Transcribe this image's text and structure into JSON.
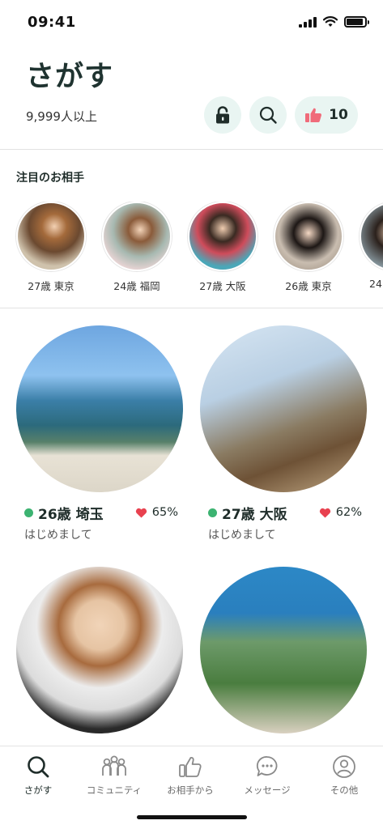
{
  "status_bar": {
    "time": "09:41",
    "battery_level": 0.9
  },
  "header": {
    "title": "さがす",
    "count_text": "9,999人以上",
    "likes_count": "10",
    "accent_color": "#e9f5f2",
    "like_icon_color": "#f06b7a"
  },
  "featured": {
    "title": "注目のお相手",
    "items": [
      {
        "label": "27歳 東京"
      },
      {
        "label": "24歳 福岡"
      },
      {
        "label": "27歳 大阪"
      },
      {
        "label": "26歳 東京"
      },
      {
        "label": "24"
      }
    ]
  },
  "cards": [
    {
      "name": "26歳 埼玉",
      "match": "65%",
      "message": "はじめまして",
      "online": true
    },
    {
      "name": "27歳 大阪",
      "match": "62%",
      "message": "はじめまして",
      "online": true
    },
    {
      "name": "",
      "match": "",
      "message": "",
      "online": false
    },
    {
      "name": "",
      "match": "",
      "message": "",
      "online": false
    }
  ],
  "tabs": [
    {
      "label": "さがす",
      "icon": "search-icon",
      "active": true
    },
    {
      "label": "コミュニティ",
      "icon": "community-icon",
      "active": false
    },
    {
      "label": "お相手から",
      "icon": "thumbs-up-icon",
      "active": false
    },
    {
      "label": "メッセージ",
      "icon": "chat-icon",
      "active": false
    },
    {
      "label": "その他",
      "icon": "user-icon",
      "active": false
    }
  ],
  "colors": {
    "online": "#3cb371",
    "heart": "#e8414f",
    "text_dark": "#1f2d2a"
  }
}
